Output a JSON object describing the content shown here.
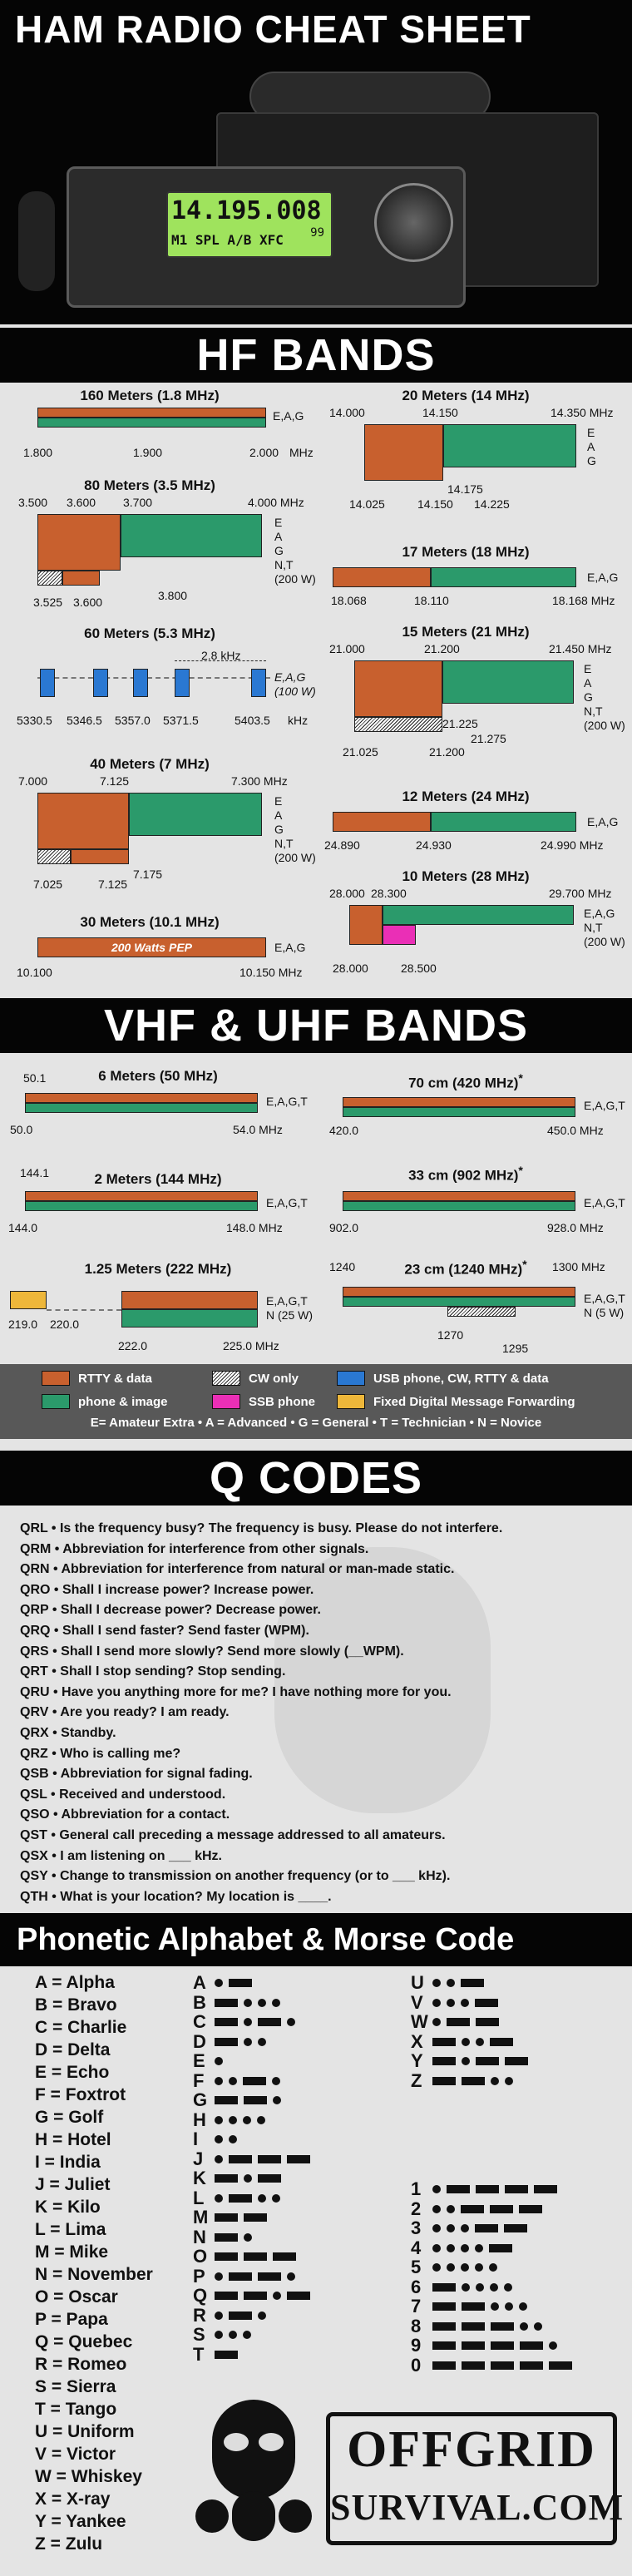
{
  "title": "HAM RADIO CHEAT SHEET",
  "radio_display": {
    "freq": "14.195.008",
    "line2": "M1  SPL  A/B  XFC",
    "small": "99"
  },
  "hf_title": "HF BANDS",
  "vhf_title": "VHF & UHF BANDS",
  "q_title": "Q CODES",
  "phon_title": "Phonetic Alphabet & Morse Code",
  "bands": {
    "b160": {
      "title": "160 Meters (1.8 MHz)",
      "ticks": [
        "1.800",
        "1.900",
        "2.000"
      ],
      "unit": "MHz",
      "modes": "E,A,G"
    },
    "b80": {
      "title": "80 Meters (3.5 MHz)",
      "ticks_top": [
        "3.500",
        "3.600",
        "3.700",
        "4.000 MHz"
      ],
      "ticks_bot": [
        "3.525",
        "3.600",
        "3.800"
      ],
      "modes": "E\nA\nG\nN,T\n(200 W)"
    },
    "b60": {
      "title": "60 Meters (5.3 MHz)",
      "span": "2.8 kHz",
      "ticks": [
        "5330.5",
        "5346.5",
        "5357.0",
        "5371.5",
        "5403.5"
      ],
      "unit": "kHz",
      "modes": "E,A,G\n(100 W)"
    },
    "b40": {
      "title": "40 Meters (7 MHz)",
      "ticks_top": [
        "7.000",
        "7.125",
        "7.300 MHz"
      ],
      "ticks_bot": [
        "7.025",
        "7.125",
        "7.175"
      ],
      "modes": "E\nA\nG\nN,T\n(200 W)"
    },
    "b30": {
      "title": "30 Meters (10.1 MHz)",
      "inner": "200 Watts PEP",
      "ticks": [
        "10.100",
        "10.150 MHz"
      ],
      "modes": "E,A,G"
    },
    "b20": {
      "title": "20 Meters (14 MHz)",
      "ticks_top": [
        "14.000",
        "14.150",
        "14.350 MHz"
      ],
      "ticks_bot": [
        "14.025",
        "14.150",
        "14.175",
        "14.225"
      ],
      "modes": "E\nA\nG"
    },
    "b17": {
      "title": "17 Meters (18 MHz)",
      "ticks": [
        "18.068",
        "18.110",
        "18.168 MHz"
      ],
      "modes": "E,A,G"
    },
    "b15": {
      "title": "15 Meters (21 MHz)",
      "ticks_top": [
        "21.000",
        "21.200",
        "21.450 MHz"
      ],
      "ticks_bot": [
        "21.025",
        "21.200",
        "21.225",
        "21.275"
      ],
      "modes": "E\nA\nG\nN,T\n(200 W)"
    },
    "b12": {
      "title": "12 Meters (24 MHz)",
      "ticks": [
        "24.890",
        "24.930",
        "24.990 MHz"
      ],
      "modes": "E,A,G"
    },
    "b10": {
      "title": "10 Meters (28 MHz)",
      "ticks_top": [
        "28.000",
        "28.300",
        "29.700 MHz"
      ],
      "ticks_bot": [
        "28.000",
        "28.500"
      ],
      "modes": "E,A,G\nN,T\n(200 W)"
    },
    "b6": {
      "title": "6 Meters (50 MHz)",
      "ticks_top": [
        "50.1"
      ],
      "ticks": [
        "50.0",
        "54.0 MHz"
      ],
      "modes": "E,A,G,T"
    },
    "b2": {
      "title": "2 Meters (144 MHz)",
      "ticks_top": [
        "144.1"
      ],
      "ticks": [
        "144.0",
        "148.0 MHz"
      ],
      "modes": "E,A,G,T"
    },
    "b125": {
      "title": "1.25 Meters (222 MHz)",
      "ticks": [
        "219.0",
        "220.0",
        "222.0",
        "225.0 MHz"
      ],
      "modes": "E,A,G,T\nN (25 W)"
    },
    "b70": {
      "title": "70 cm (420 MHz)",
      "star": "*",
      "ticks": [
        "420.0",
        "450.0 MHz"
      ],
      "modes": "E,A,G,T"
    },
    "b33": {
      "title": "33 cm (902 MHz)",
      "star": "*",
      "ticks": [
        "902.0",
        "928.0 MHz"
      ],
      "modes": "E,A,G,T"
    },
    "b23": {
      "title": "23 cm (1240 MHz)",
      "star": "*",
      "ticks_top": [
        "1240",
        "1300 MHz"
      ],
      "ticks_bot": [
        "1270",
        "1295"
      ],
      "modes": "E,A,G,T\nN (5 W)"
    }
  },
  "legend": {
    "items": [
      "RTTY & data",
      "CW only",
      "USB phone, CW, RTTY & data",
      "phone & image",
      "SSB phone",
      "Fixed Digital Message Forwarding"
    ],
    "footer": "E= Amateur Extra • A = Advanced • G = General • T = Technician • N = Novice"
  },
  "qcodes": [
    "QRL  •  Is the frequency busy? The frequency is busy. Please do not interfere.",
    "QRM • Abbreviation for interference from other signals.",
    "QRN • Abbreviation for interference from natural or man-made static.",
    "QRO • Shall I increase power? Increase power.",
    "QRP • Shall I decrease power? Decrease power.",
    "QRQ • Shall I send faster? Send faster (WPM).",
    "QRS • Shall I send more slowly? Send more slowly (__WPM).",
    "QRT • Shall I stop sending? Stop sending.",
    "QRU • Have you anything more for me? I have nothing more for you.",
    "QRV • Are you ready? I am ready.",
    "QRX • Standby.",
    "QRZ  • Who is calling me?",
    "QSB • Abbreviation for signal fading.",
    "QSL • Received and understood.",
    "QSO • Abbreviation for a contact.",
    "QST • General call preceding a message addressed to all amateurs.",
    "QSX • I am listening on ___ kHz.",
    "QSY • Change to transmission on another frequency (or to ___ kHz).",
    "QTH • What is your location? My location is ____."
  ],
  "phonetic": [
    "A = Alpha",
    "B = Bravo",
    "C = Charlie",
    "D = Delta",
    "E = Echo",
    "F = Foxtrot",
    "G = Golf",
    "H = Hotel",
    "I = India",
    "J = Juliet",
    "K = Kilo",
    "L = Lima",
    "M = Mike",
    "N = November",
    "O = Oscar",
    "P = Papa",
    "Q = Quebec",
    "R = Romeo",
    "S = Sierra",
    "T = Tango",
    "U = Uniform",
    "V = Victor",
    "W = Whiskey",
    "X = X-ray",
    "Y = Yankee",
    "Z = Zulu"
  ],
  "morse_letters": [
    "A",
    "B",
    "C",
    "D",
    "E",
    "F",
    "G",
    "H",
    "I",
    "J",
    "K",
    "L",
    "M",
    "N",
    "O",
    "P",
    "Q",
    "R",
    "S",
    "T",
    "U",
    "V",
    "W",
    "X",
    "Y",
    "Z"
  ],
  "morse_codes": [
    ".-",
    "-...",
    "-.-.",
    "-..",
    ".",
    "..-.",
    "--.",
    "....",
    "..",
    ".---",
    "-.-",
    ".-..",
    "--",
    "-.",
    "---",
    ".--.",
    "--.-",
    ".-.",
    "...",
    "-",
    "..-",
    "...-",
    ".--",
    "-..-",
    "-.--",
    "--.."
  ],
  "morse_digits": [
    "1",
    "2",
    "3",
    "4",
    "5",
    "6",
    "7",
    "8",
    "9",
    "0"
  ],
  "morse_digit_codes": [
    ".----",
    "..---",
    "...--",
    "....-",
    ".....",
    "-....",
    "--...",
    "---..",
    "----.",
    "-----"
  ],
  "logo": {
    "line1": "OFFGRID",
    "line2": "SURVIVAL.COM"
  },
  "colors": {
    "rtty": "#c8602e",
    "phone": "#2b9a6b",
    "usb": "#2a78d2",
    "ssb": "#ea2fb6",
    "fixed": "#eeb73a"
  }
}
